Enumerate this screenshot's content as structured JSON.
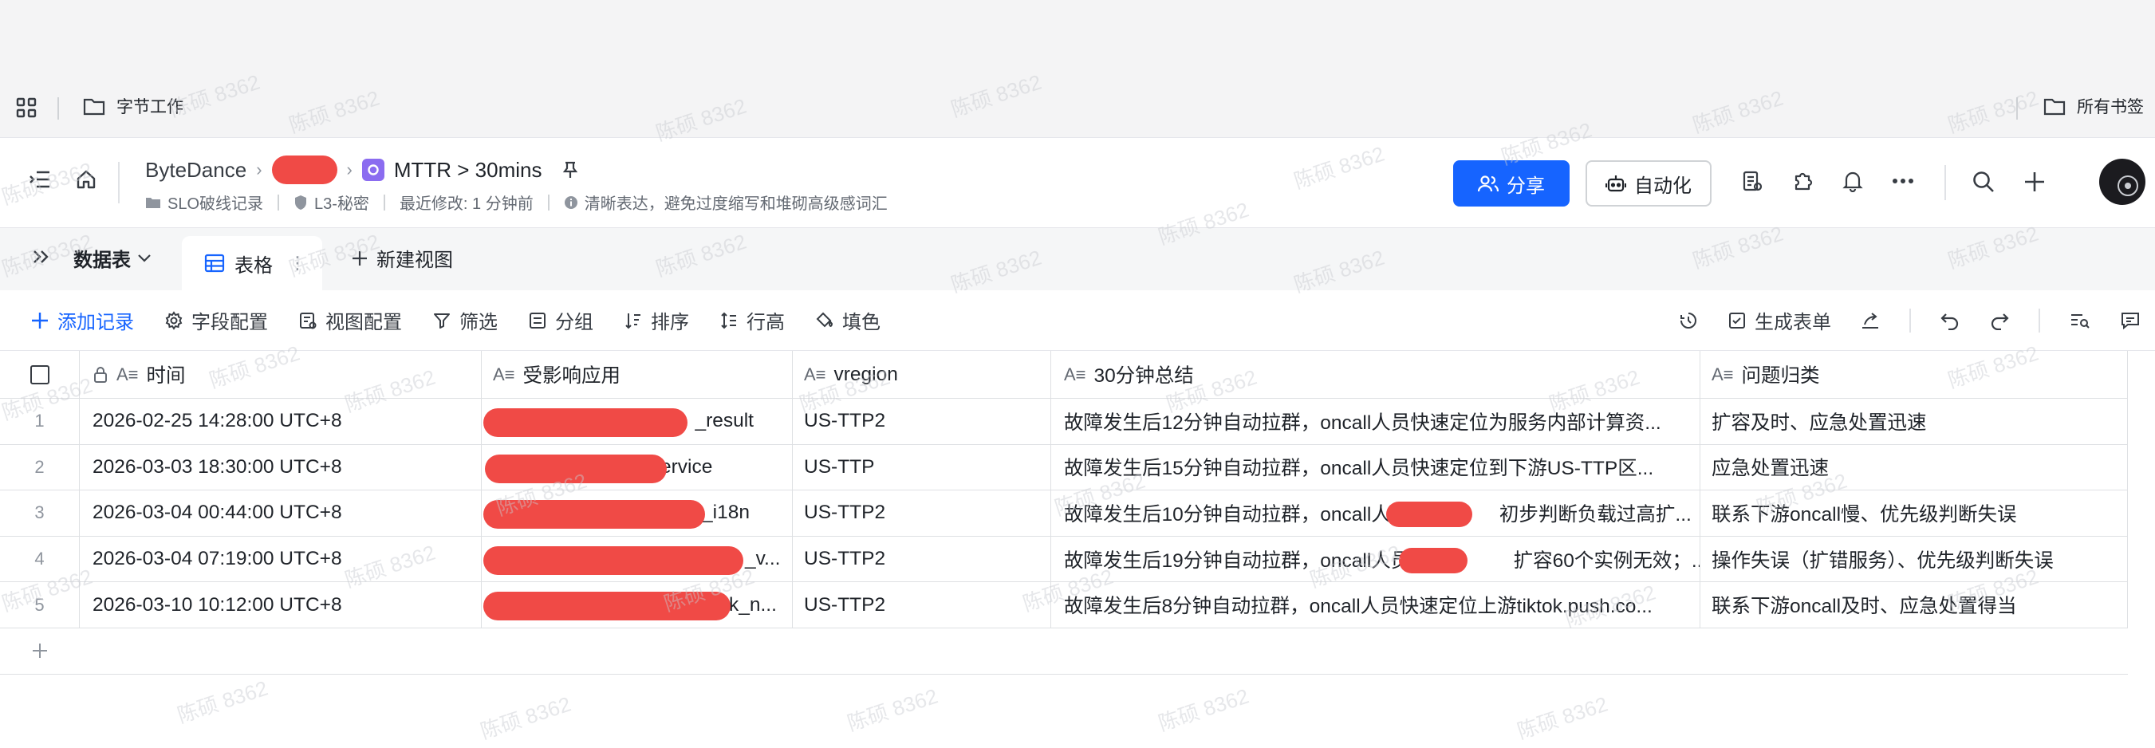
{
  "bookmarks": {
    "folder_label": "字节工作",
    "all_label": "所有书签"
  },
  "header": {
    "breadcrumb": {
      "org": "ByteDance",
      "doc_title": "MTTR > 30mins"
    },
    "meta": {
      "folder": "SLO破线记录",
      "security": "L3-秘密",
      "modified": "最近修改: 1 分钟前",
      "hint": "清晰表达，避免过度缩写和堆砌高级感词汇"
    },
    "share_label": "分享",
    "automation_label": "自动化"
  },
  "tabs": {
    "datasheet_label": "数据表",
    "grid_tab_label": "表格",
    "new_view_label": "新建视图"
  },
  "toolbar": {
    "add_record": "添加记录",
    "fields": "字段配置",
    "view_config": "视图配置",
    "filter": "筛选",
    "group": "分组",
    "sort": "排序",
    "row_height": "行高",
    "fill": "填色",
    "generate_form": "生成表单"
  },
  "table": {
    "columns": [
      "时间",
      "受影响应用",
      "vregion",
      "30分钟总结",
      "问题归类"
    ],
    "rows": [
      {
        "index": "1",
        "time": "2026-02-25 14:28:00 UTC+8",
        "app": "_result",
        "vregion": "US-TTP2",
        "summary": "故障发生后12分钟自动拉群，oncall人员快速定位为服务内部计算资...",
        "category": "扩容及时、应急处置迅速"
      },
      {
        "index": "2",
        "time": "2026-03-03 18:30:00 UTC+8",
        "app": "ervice",
        "vregion": "US-TTP",
        "summary": "故障发生后15分钟自动拉群，oncall人员快速定位到下游US-TTP区...",
        "category": "应急处置迅速"
      },
      {
        "index": "3",
        "time": "2026-03-04 00:44:00 UTC+8",
        "app": "_i18n",
        "vregion": "US-TTP2",
        "summary": "故障发生后10分钟自动拉群，oncall人                    初步判断负载过高扩...",
        "category": "联系下游oncall慢、优先级判断失误"
      },
      {
        "index": "4",
        "time": "2026-03-04 07:19:00 UTC+8",
        "app": "_v...",
        "vregion": "US-TTP2",
        "summary": "故障发生后19分钟自动拉群，oncall人员                   扩容60个实例无效；...",
        "category": "操作失误（扩错服务）、优先级判断失误"
      },
      {
        "index": "5",
        "time": "2026-03-10 10:12:00 UTC+8",
        "app": "k_n...",
        "vregion": "US-TTP2",
        "summary": "故障发生后8分钟自动拉群，oncall人员快速定位上游tiktok.push.co...",
        "category": "联系下游oncall及时、应急处置得当"
      }
    ]
  },
  "watermark": "陈硕 8362",
  "colors": {
    "primary": "#1664ff",
    "redaction": "#f04a46",
    "doc_badge": "#8b6cf0"
  }
}
